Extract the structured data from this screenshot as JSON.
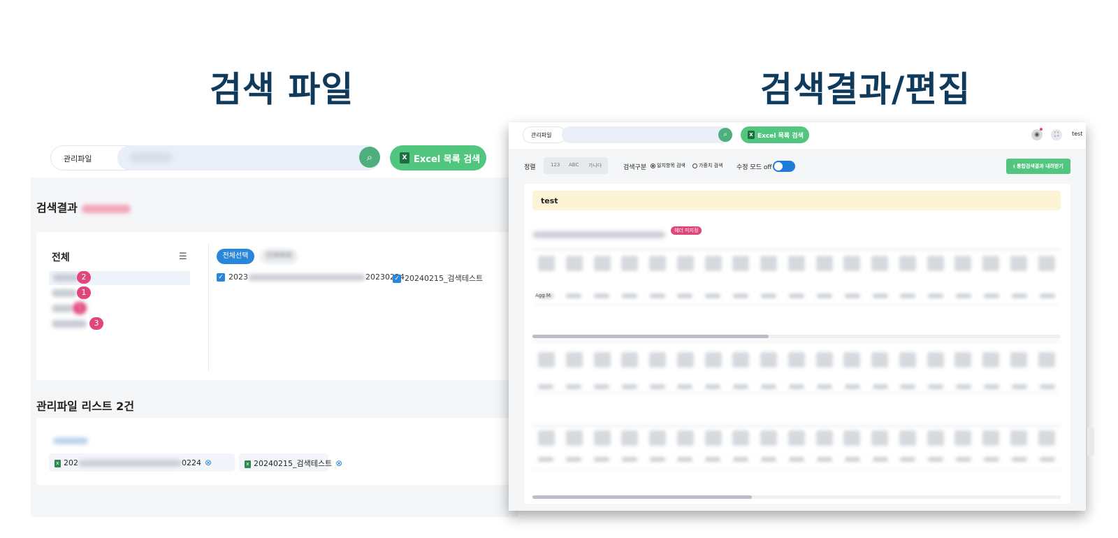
{
  "headings": {
    "left": "검색 파일",
    "right": "검색결과/편집"
  },
  "left": {
    "dropdown": "관리파일",
    "excel_button": "Excel 목록 검색",
    "result_title": "검색결과",
    "category_title": "전체",
    "categories": [
      {
        "count": "2"
      },
      {
        "count": "1"
      },
      {
        "count": "1"
      },
      {
        "count": "3"
      }
    ],
    "select_all": "전체선택",
    "deselect": "전체해제",
    "files": [
      "2023 0224",
      "20240215_검색테스트"
    ],
    "file_first_prefix": "2023",
    "file_first_suffix": "20230224",
    "list_title": "관리파일 리스트 2건",
    "chips": [
      {
        "prefix": "202",
        "suffix": "0224"
      },
      {
        "label": "20240215_검색테스트"
      }
    ],
    "colors": {
      "accent_green": "#52c67f",
      "badge_pink": "#e0457b",
      "heading_navy": "#0f3a5c",
      "check_blue": "#2a86d8"
    }
  },
  "right": {
    "dropdown": "관리파일",
    "excel_button": "Excel 목록 검색",
    "user_name": "test",
    "sort_label": "정렬",
    "sort_options": [
      "123",
      "ABC",
      "가나다"
    ],
    "search_type_label": "검색구분",
    "radio_exact": "일치항목 검색",
    "radio_weighted": "가중치 검색",
    "edit_mode_label": "수정 모드 off",
    "download_button": "통합검색결과 내려받기",
    "result_header": "test",
    "tag": "헤더 미지정",
    "row_label": "Agg M"
  }
}
